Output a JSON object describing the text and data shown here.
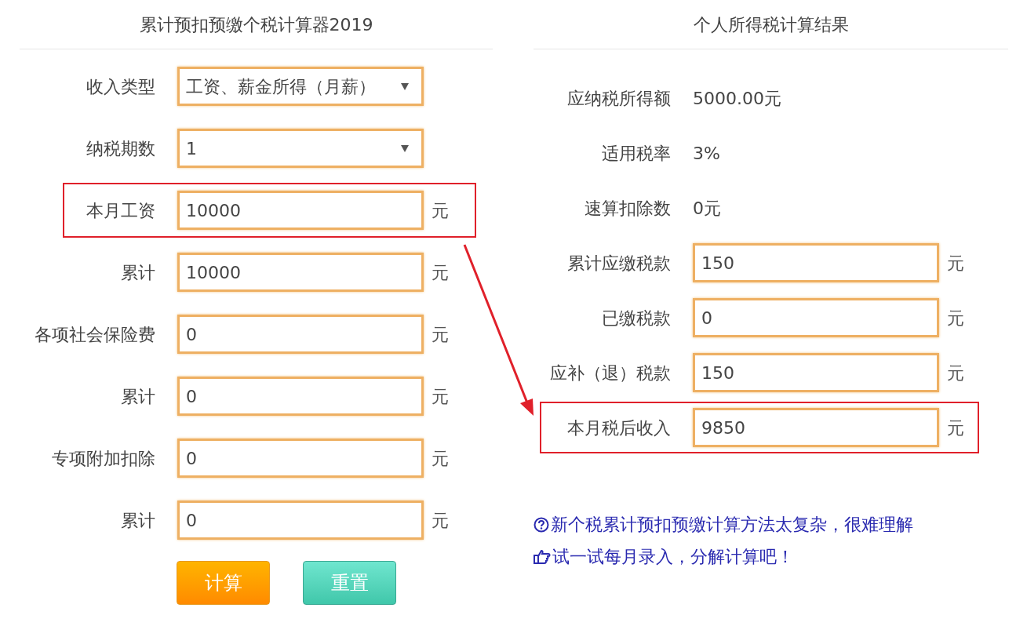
{
  "calculator": {
    "title": "累计预扣预缴个税计算器2019",
    "rows": [
      {
        "kind": "select",
        "label": "收入类型",
        "value": "工资、薪金所得（月薪）",
        "highlighted": false
      },
      {
        "kind": "select",
        "label": "纳税期数",
        "value": "1",
        "highlighted": false
      },
      {
        "kind": "input",
        "label": "本月工资",
        "value": "10000",
        "unit": "元",
        "highlighted": true
      },
      {
        "kind": "input",
        "label": "累计",
        "value": "10000",
        "unit": "元",
        "highlighted": false
      },
      {
        "kind": "input",
        "label": "各项社会保险费",
        "value": "0",
        "unit": "元",
        "highlighted": false
      },
      {
        "kind": "input",
        "label": "累计",
        "value": "0",
        "unit": "元",
        "highlighted": false
      },
      {
        "kind": "input",
        "label": "专项附加扣除",
        "value": "0",
        "unit": "元",
        "highlighted": false
      },
      {
        "kind": "input",
        "label": "累计",
        "value": "0",
        "unit": "元",
        "highlighted": false
      }
    ],
    "buttons": [
      {
        "label": "计算",
        "kind": "primary"
      },
      {
        "label": "重置",
        "kind": "secondary"
      }
    ]
  },
  "result": {
    "title": "个人所得税计算结果",
    "rows": [
      {
        "kind": "text",
        "label": "应纳税所得额",
        "value": "5000.00元",
        "highlighted": false
      },
      {
        "kind": "text",
        "label": "适用税率",
        "value": "3%",
        "highlighted": false
      },
      {
        "kind": "text",
        "label": "速算扣除数",
        "value": "0元",
        "highlighted": false
      },
      {
        "kind": "input",
        "label": "累计应缴税款",
        "value": "150",
        "unit": "元",
        "highlighted": false
      },
      {
        "kind": "input",
        "label": "已缴税款",
        "value": "0",
        "unit": "元",
        "highlighted": false
      },
      {
        "kind": "input",
        "label": "应补（退）税款",
        "value": "150",
        "unit": "元",
        "highlighted": false
      },
      {
        "kind": "input",
        "label": "本月税后收入",
        "value": "9850",
        "unit": "元",
        "highlighted": true
      }
    ],
    "links": [
      {
        "kind": "question",
        "text": "新个税累计预扣预缴计算方法太复杂，很难理解"
      },
      {
        "kind": "pointer",
        "text": "试一试每月录入，分解计算吧！"
      }
    ]
  }
}
